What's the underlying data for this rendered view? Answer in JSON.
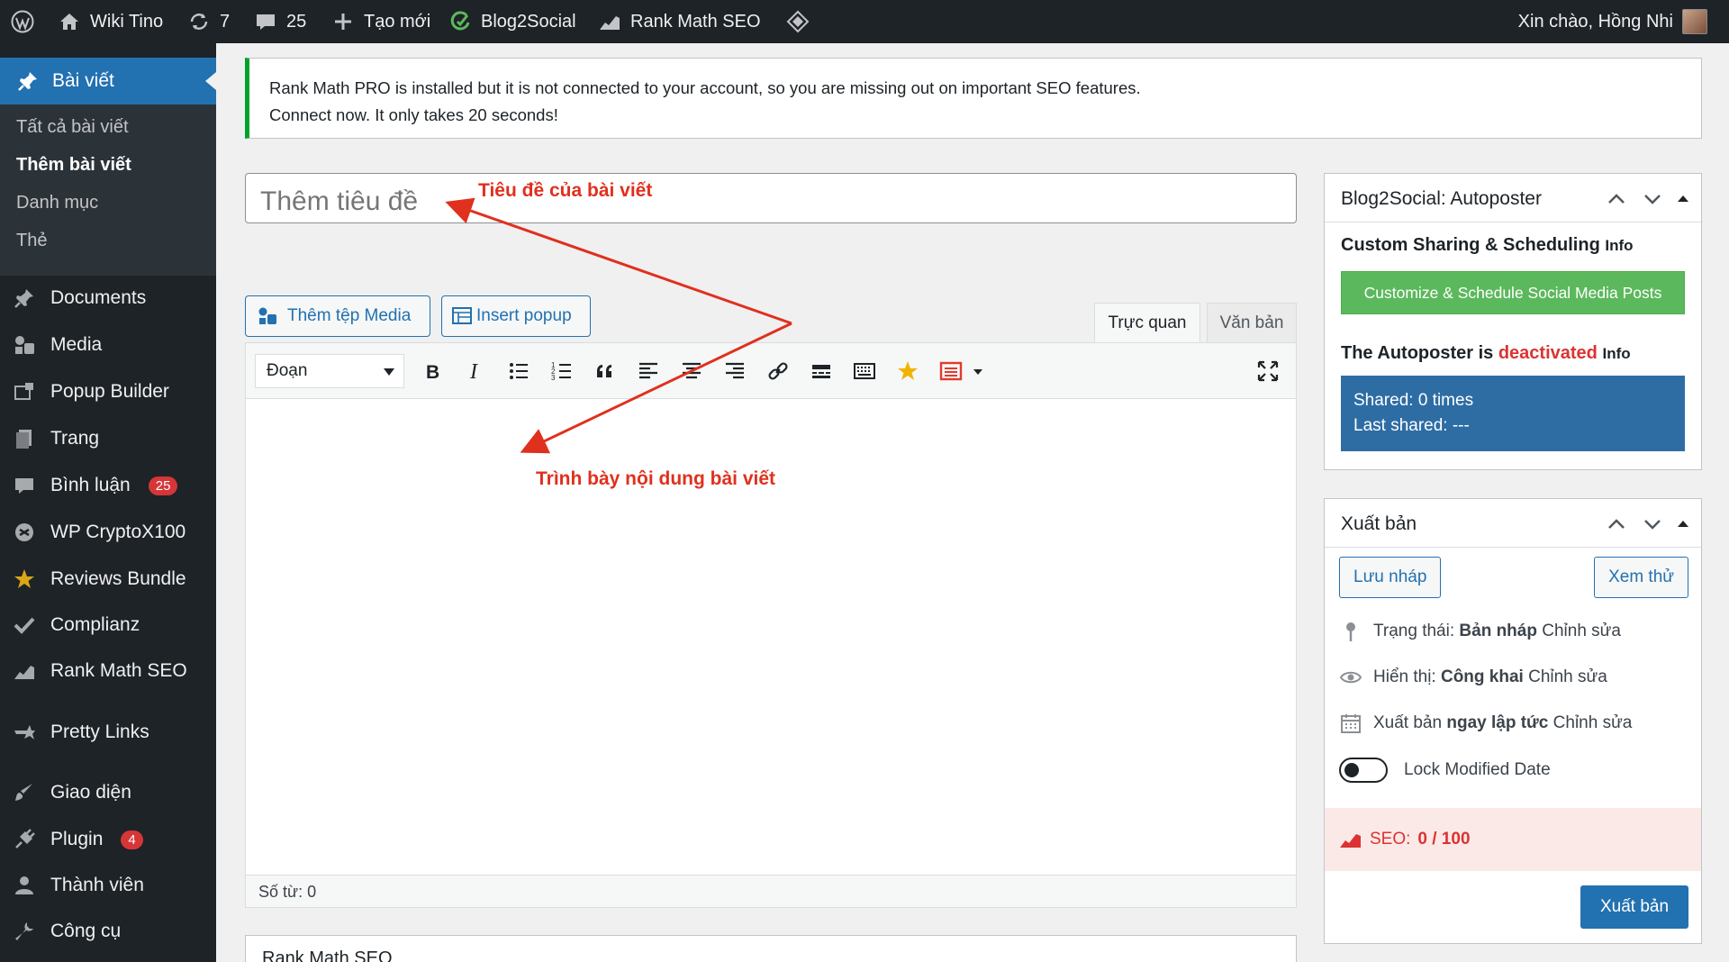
{
  "adminbar": {
    "site_name": "Wiki Tino",
    "updates_count": "7",
    "comments_count": "25",
    "new_label": "Tạo mới",
    "blog2social_label": "Blog2Social",
    "rankmath_label": "Rank Math SEO",
    "greeting": "Xin chào, Hồng Nhi"
  },
  "sidebar": {
    "current": "Bài viết",
    "submenu": [
      "Tất cả bài viết",
      "Thêm bài viết",
      "Danh mục",
      "Thẻ"
    ],
    "items": [
      {
        "label": "Documents"
      },
      {
        "label": "Media"
      },
      {
        "label": "Popup Builder"
      },
      {
        "label": "Trang"
      },
      {
        "label": "Bình luận",
        "count": "25"
      },
      {
        "label": "WP CryptoX100"
      },
      {
        "label": "Reviews Bundle"
      },
      {
        "label": "Complianz"
      },
      {
        "label": "Rank Math SEO"
      },
      {
        "label": "Pretty Links"
      },
      {
        "label": "Giao diện"
      },
      {
        "label": "Plugin",
        "count": "4"
      },
      {
        "label": "Thành viên"
      },
      {
        "label": "Công cụ"
      }
    ]
  },
  "notice": {
    "line1": "Rank Math PRO is installed but it is not connected to your account, so you are missing out on important SEO features.",
    "line2": "Connect now. It only takes 20 seconds!"
  },
  "editor": {
    "title_placeholder": "Thêm tiêu đề",
    "add_media": "Thêm tệp Media",
    "insert_popup": "Insert popup",
    "tab_visual": "Trực quan",
    "tab_text": "Văn bản",
    "format_value": "Đoạn",
    "word_count": "Số từ: 0"
  },
  "annotations": {
    "title_note": "Tiêu đề của bài viết",
    "content_note": "Trình bày nội dung bài viết"
  },
  "rankmath_panel": {
    "title": "Rank Math SEO"
  },
  "blog2social": {
    "title": "Blog2Social: Autoposter",
    "custom_heading": "Custom Sharing & Scheduling",
    "info": "Info",
    "customize_btn": "Customize & Schedule Social Media Posts",
    "autoposter_prefix": "The Autoposter is",
    "autoposter_status": "deactivated",
    "shared": "Shared: 0 times",
    "last_shared": "Last shared: ---"
  },
  "publish": {
    "title": "Xuất bản",
    "save_draft": "Lưu nháp",
    "preview": "Xem thử",
    "status_label": "Trạng thái:",
    "status_value": "Bản nháp",
    "visibility_label": "Hiển thị:",
    "visibility_value": "Công khai",
    "publish_label": "Xuất bản",
    "publish_value": "ngay lập tức",
    "edit": "Chỉnh sửa",
    "lock_modified": "Lock Modified Date",
    "seo_label": "SEO:",
    "seo_score": "0 / 100",
    "publish_btn": "Xuất bản"
  },
  "colors": {
    "admin_bg": "#1d2327",
    "accent": "#2271b1",
    "annotation": "#e0301e",
    "notice_green": "#00a32a",
    "deactivated": "#dc3232"
  }
}
